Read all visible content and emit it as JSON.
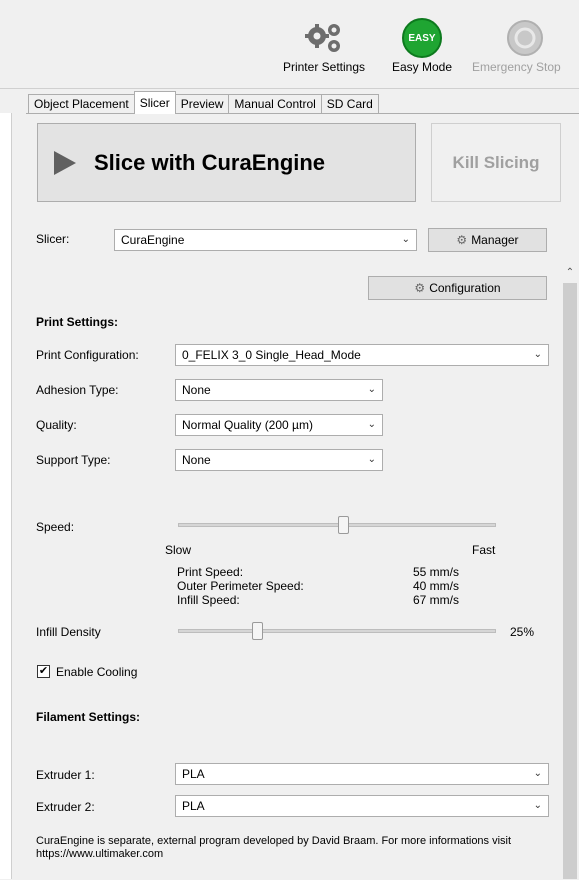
{
  "toolbar": {
    "printer_settings": "Printer Settings",
    "easy_mode": "Easy Mode",
    "easy_badge": "EASY",
    "emergency_stop": "Emergency Stop"
  },
  "tabs": [
    "Object Placement",
    "Slicer",
    "Preview",
    "Manual Control",
    "SD Card"
  ],
  "slice_button": "Slice with CuraEngine",
  "kill_button": "Kill Slicing",
  "slicer": {
    "label": "Slicer:",
    "value": "CuraEngine",
    "manager": "Manager"
  },
  "configuration_button": "Configuration",
  "print_settings": {
    "heading": "Print Settings:",
    "print_configuration": {
      "label": "Print Configuration:",
      "value": "0_FELIX 3_0 Single_Head_Mode"
    },
    "adhesion": {
      "label": "Adhesion Type:",
      "value": "None"
    },
    "quality": {
      "label": "Quality:",
      "value": "Normal Quality (200 µm)"
    },
    "support": {
      "label": "Support Type:",
      "value": "None"
    }
  },
  "speed": {
    "label": "Speed:",
    "slow": "Slow",
    "fast": "Fast",
    "level": 0.52,
    "print_speed_label": "Print Speed:",
    "print_speed_value": "55 mm/s",
    "outer_label": "Outer Perimeter Speed:",
    "outer_value": "40 mm/s",
    "infill_label": "Infill Speed:",
    "infill_value": "67 mm/s"
  },
  "infill": {
    "label": "Infill Density",
    "value": "25%",
    "level": 0.25
  },
  "cooling": {
    "label": "Enable Cooling",
    "checked": true,
    "check": "✔"
  },
  "filament": {
    "heading": "Filament Settings:",
    "extruder1": {
      "label": "Extruder 1:",
      "value": "PLA"
    },
    "extruder2": {
      "label": "Extruder 2:",
      "value": "PLA"
    }
  },
  "footer": "CuraEngine is separate, external program developed by David Braam. For more informations visit https://www.ultimaker.com",
  "icons": {
    "printer_settings": "gears-icon",
    "easy_mode": "easy-badge-icon",
    "emergency_stop": "emergency-stop-icon"
  }
}
